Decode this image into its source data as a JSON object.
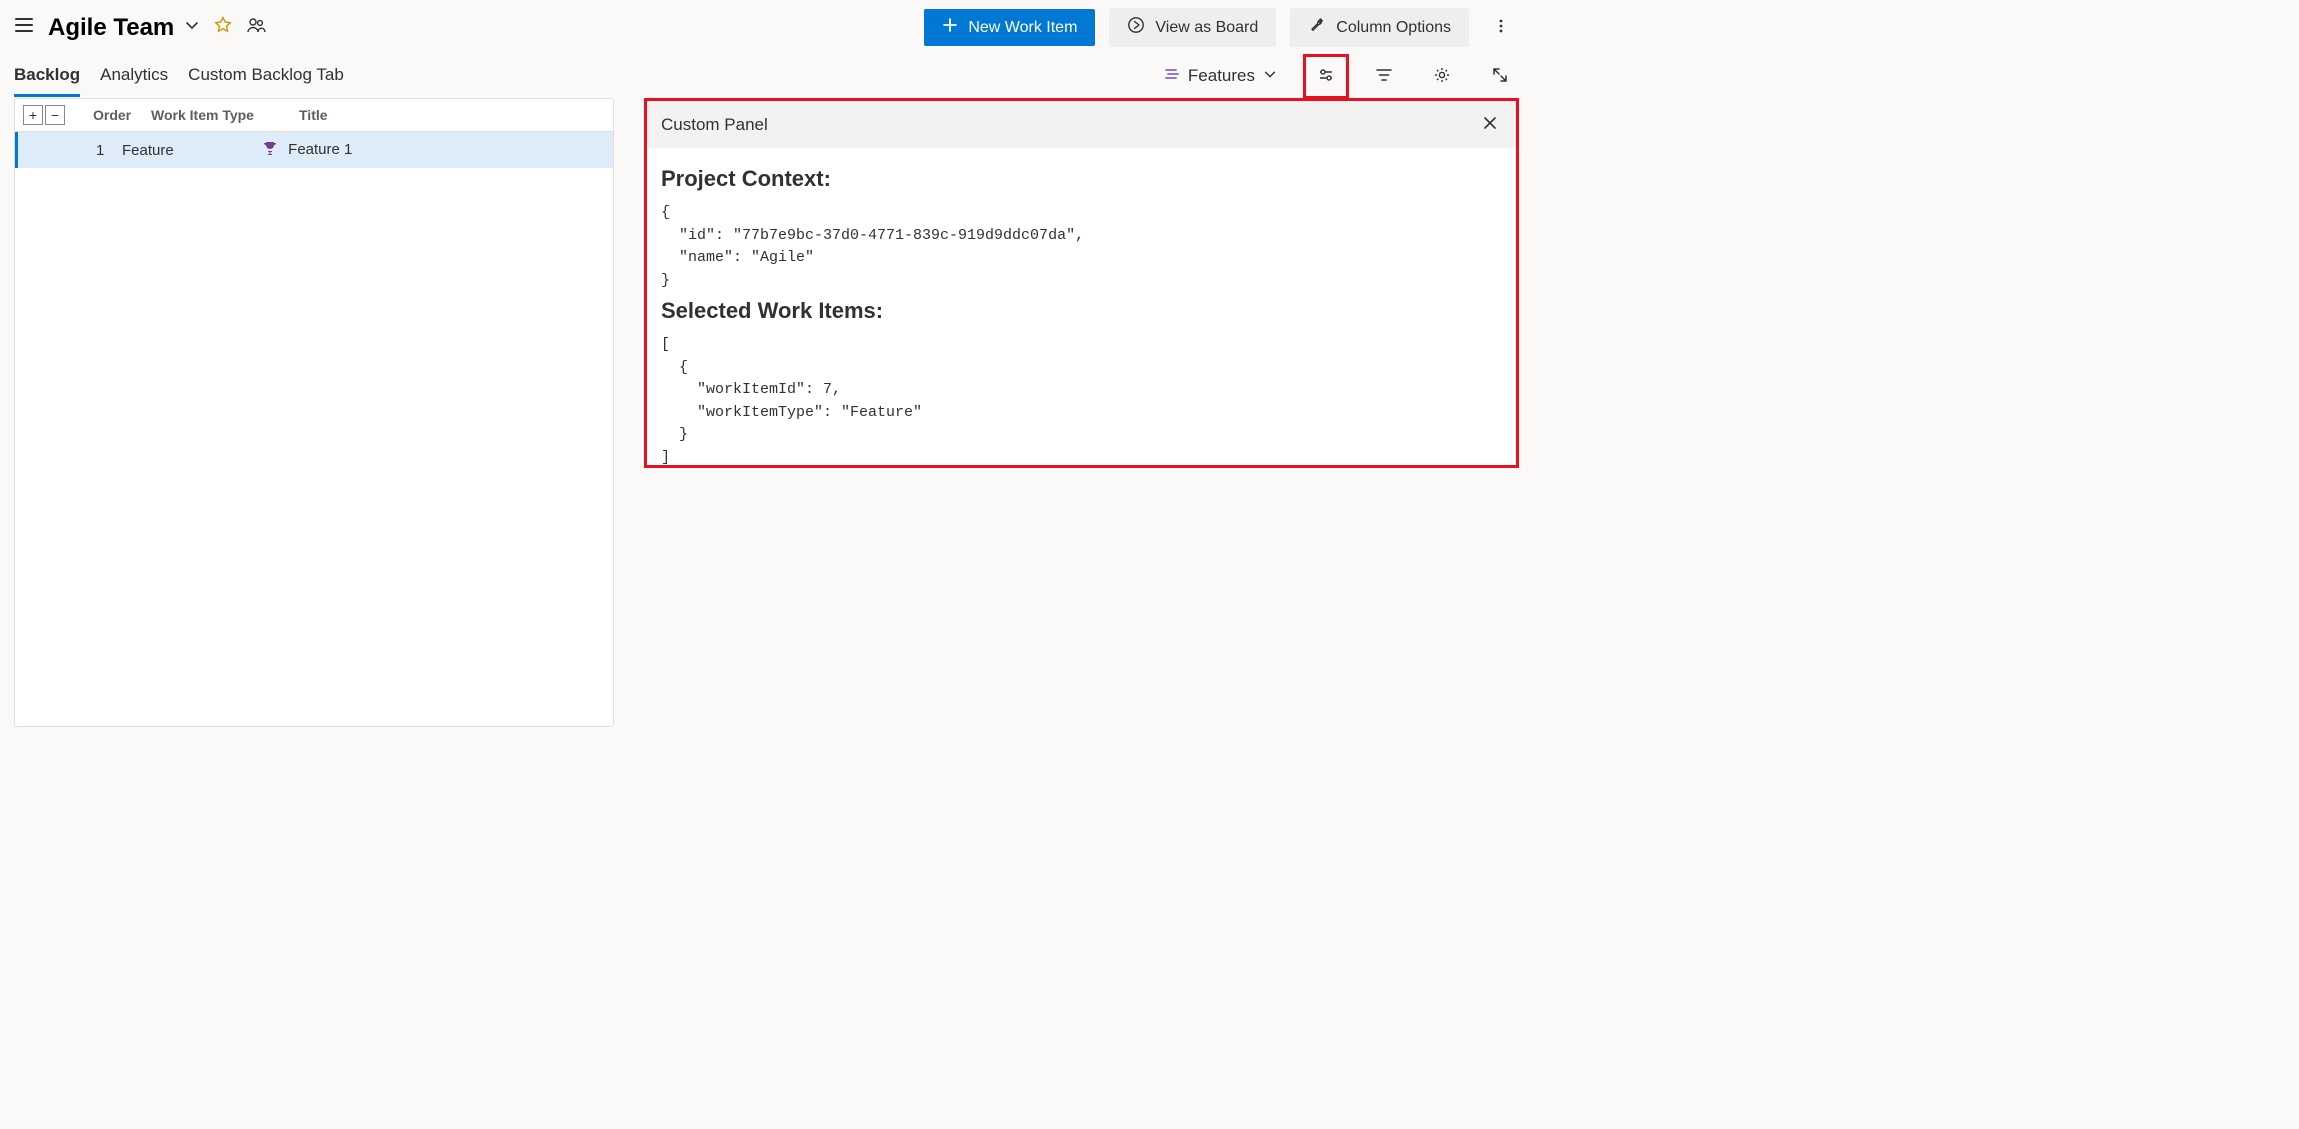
{
  "header": {
    "team_name": "Agile Team",
    "new_work_item_label": "New Work Item",
    "view_as_board_label": "View as Board",
    "column_options_label": "Column Options"
  },
  "tabs": {
    "items": [
      "Backlog",
      "Analytics",
      "Custom Backlog Tab"
    ],
    "active_index": 0
  },
  "level_selector": {
    "label": "Features"
  },
  "grid": {
    "columns": {
      "order": "Order",
      "type": "Work Item Type",
      "title": "Title"
    },
    "rows": [
      {
        "order": "1",
        "type": "Feature",
        "title": "Feature 1",
        "icon": "trophy-icon"
      }
    ]
  },
  "panel": {
    "title": "Custom Panel",
    "project_context_heading": "Project Context:",
    "project_context_json": "{\n  \"id\": \"77b7e9bc-37d0-4771-839c-919d9ddc07da\",\n  \"name\": \"Agile\"\n}",
    "selected_items_heading": "Selected Work Items:",
    "selected_items_json": "[\n  {\n    \"workItemId\": 7,\n    \"workItemType\": \"Feature\"\n  }\n]"
  }
}
